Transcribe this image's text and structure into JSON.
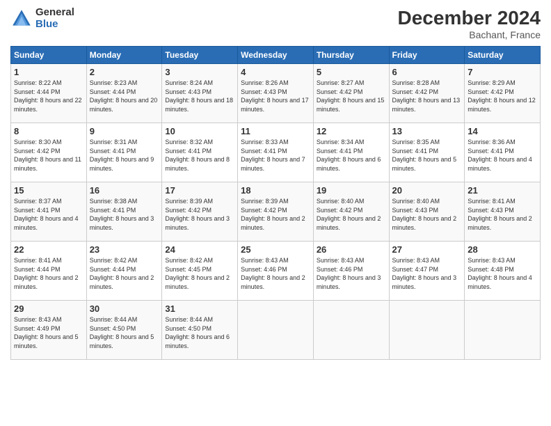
{
  "header": {
    "logo_general": "General",
    "logo_blue": "Blue",
    "month_title": "December 2024",
    "location": "Bachant, France"
  },
  "days_of_week": [
    "Sunday",
    "Monday",
    "Tuesday",
    "Wednesday",
    "Thursday",
    "Friday",
    "Saturday"
  ],
  "weeks": [
    [
      {
        "day": "1",
        "sunrise": "8:22 AM",
        "sunset": "4:44 PM",
        "daylight": "8 hours and 22 minutes."
      },
      {
        "day": "2",
        "sunrise": "8:23 AM",
        "sunset": "4:44 PM",
        "daylight": "8 hours and 20 minutes."
      },
      {
        "day": "3",
        "sunrise": "8:24 AM",
        "sunset": "4:43 PM",
        "daylight": "8 hours and 18 minutes."
      },
      {
        "day": "4",
        "sunrise": "8:26 AM",
        "sunset": "4:43 PM",
        "daylight": "8 hours and 17 minutes."
      },
      {
        "day": "5",
        "sunrise": "8:27 AM",
        "sunset": "4:42 PM",
        "daylight": "8 hours and 15 minutes."
      },
      {
        "day": "6",
        "sunrise": "8:28 AM",
        "sunset": "4:42 PM",
        "daylight": "8 hours and 13 minutes."
      },
      {
        "day": "7",
        "sunrise": "8:29 AM",
        "sunset": "4:42 PM",
        "daylight": "8 hours and 12 minutes."
      }
    ],
    [
      {
        "day": "8",
        "sunrise": "8:30 AM",
        "sunset": "4:42 PM",
        "daylight": "8 hours and 11 minutes."
      },
      {
        "day": "9",
        "sunrise": "8:31 AM",
        "sunset": "4:41 PM",
        "daylight": "8 hours and 9 minutes."
      },
      {
        "day": "10",
        "sunrise": "8:32 AM",
        "sunset": "4:41 PM",
        "daylight": "8 hours and 8 minutes."
      },
      {
        "day": "11",
        "sunrise": "8:33 AM",
        "sunset": "4:41 PM",
        "daylight": "8 hours and 7 minutes."
      },
      {
        "day": "12",
        "sunrise": "8:34 AM",
        "sunset": "4:41 PM",
        "daylight": "8 hours and 6 minutes."
      },
      {
        "day": "13",
        "sunrise": "8:35 AM",
        "sunset": "4:41 PM",
        "daylight": "8 hours and 5 minutes."
      },
      {
        "day": "14",
        "sunrise": "8:36 AM",
        "sunset": "4:41 PM",
        "daylight": "8 hours and 4 minutes."
      }
    ],
    [
      {
        "day": "15",
        "sunrise": "8:37 AM",
        "sunset": "4:41 PM",
        "daylight": "8 hours and 4 minutes."
      },
      {
        "day": "16",
        "sunrise": "8:38 AM",
        "sunset": "4:41 PM",
        "daylight": "8 hours and 3 minutes."
      },
      {
        "day": "17",
        "sunrise": "8:39 AM",
        "sunset": "4:42 PM",
        "daylight": "8 hours and 3 minutes."
      },
      {
        "day": "18",
        "sunrise": "8:39 AM",
        "sunset": "4:42 PM",
        "daylight": "8 hours and 2 minutes."
      },
      {
        "day": "19",
        "sunrise": "8:40 AM",
        "sunset": "4:42 PM",
        "daylight": "8 hours and 2 minutes."
      },
      {
        "day": "20",
        "sunrise": "8:40 AM",
        "sunset": "4:43 PM",
        "daylight": "8 hours and 2 minutes."
      },
      {
        "day": "21",
        "sunrise": "8:41 AM",
        "sunset": "4:43 PM",
        "daylight": "8 hours and 2 minutes."
      }
    ],
    [
      {
        "day": "22",
        "sunrise": "8:41 AM",
        "sunset": "4:44 PM",
        "daylight": "8 hours and 2 minutes."
      },
      {
        "day": "23",
        "sunrise": "8:42 AM",
        "sunset": "4:44 PM",
        "daylight": "8 hours and 2 minutes."
      },
      {
        "day": "24",
        "sunrise": "8:42 AM",
        "sunset": "4:45 PM",
        "daylight": "8 hours and 2 minutes."
      },
      {
        "day": "25",
        "sunrise": "8:43 AM",
        "sunset": "4:46 PM",
        "daylight": "8 hours and 2 minutes."
      },
      {
        "day": "26",
        "sunrise": "8:43 AM",
        "sunset": "4:46 PM",
        "daylight": "8 hours and 3 minutes."
      },
      {
        "day": "27",
        "sunrise": "8:43 AM",
        "sunset": "4:47 PM",
        "daylight": "8 hours and 3 minutes."
      },
      {
        "day": "28",
        "sunrise": "8:43 AM",
        "sunset": "4:48 PM",
        "daylight": "8 hours and 4 minutes."
      }
    ],
    [
      {
        "day": "29",
        "sunrise": "8:43 AM",
        "sunset": "4:49 PM",
        "daylight": "8 hours and 5 minutes."
      },
      {
        "day": "30",
        "sunrise": "8:44 AM",
        "sunset": "4:50 PM",
        "daylight": "8 hours and 5 minutes."
      },
      {
        "day": "31",
        "sunrise": "8:44 AM",
        "sunset": "4:50 PM",
        "daylight": "8 hours and 6 minutes."
      },
      null,
      null,
      null,
      null
    ]
  ],
  "labels": {
    "sunrise": "Sunrise:",
    "sunset": "Sunset:",
    "daylight": "Daylight:"
  }
}
